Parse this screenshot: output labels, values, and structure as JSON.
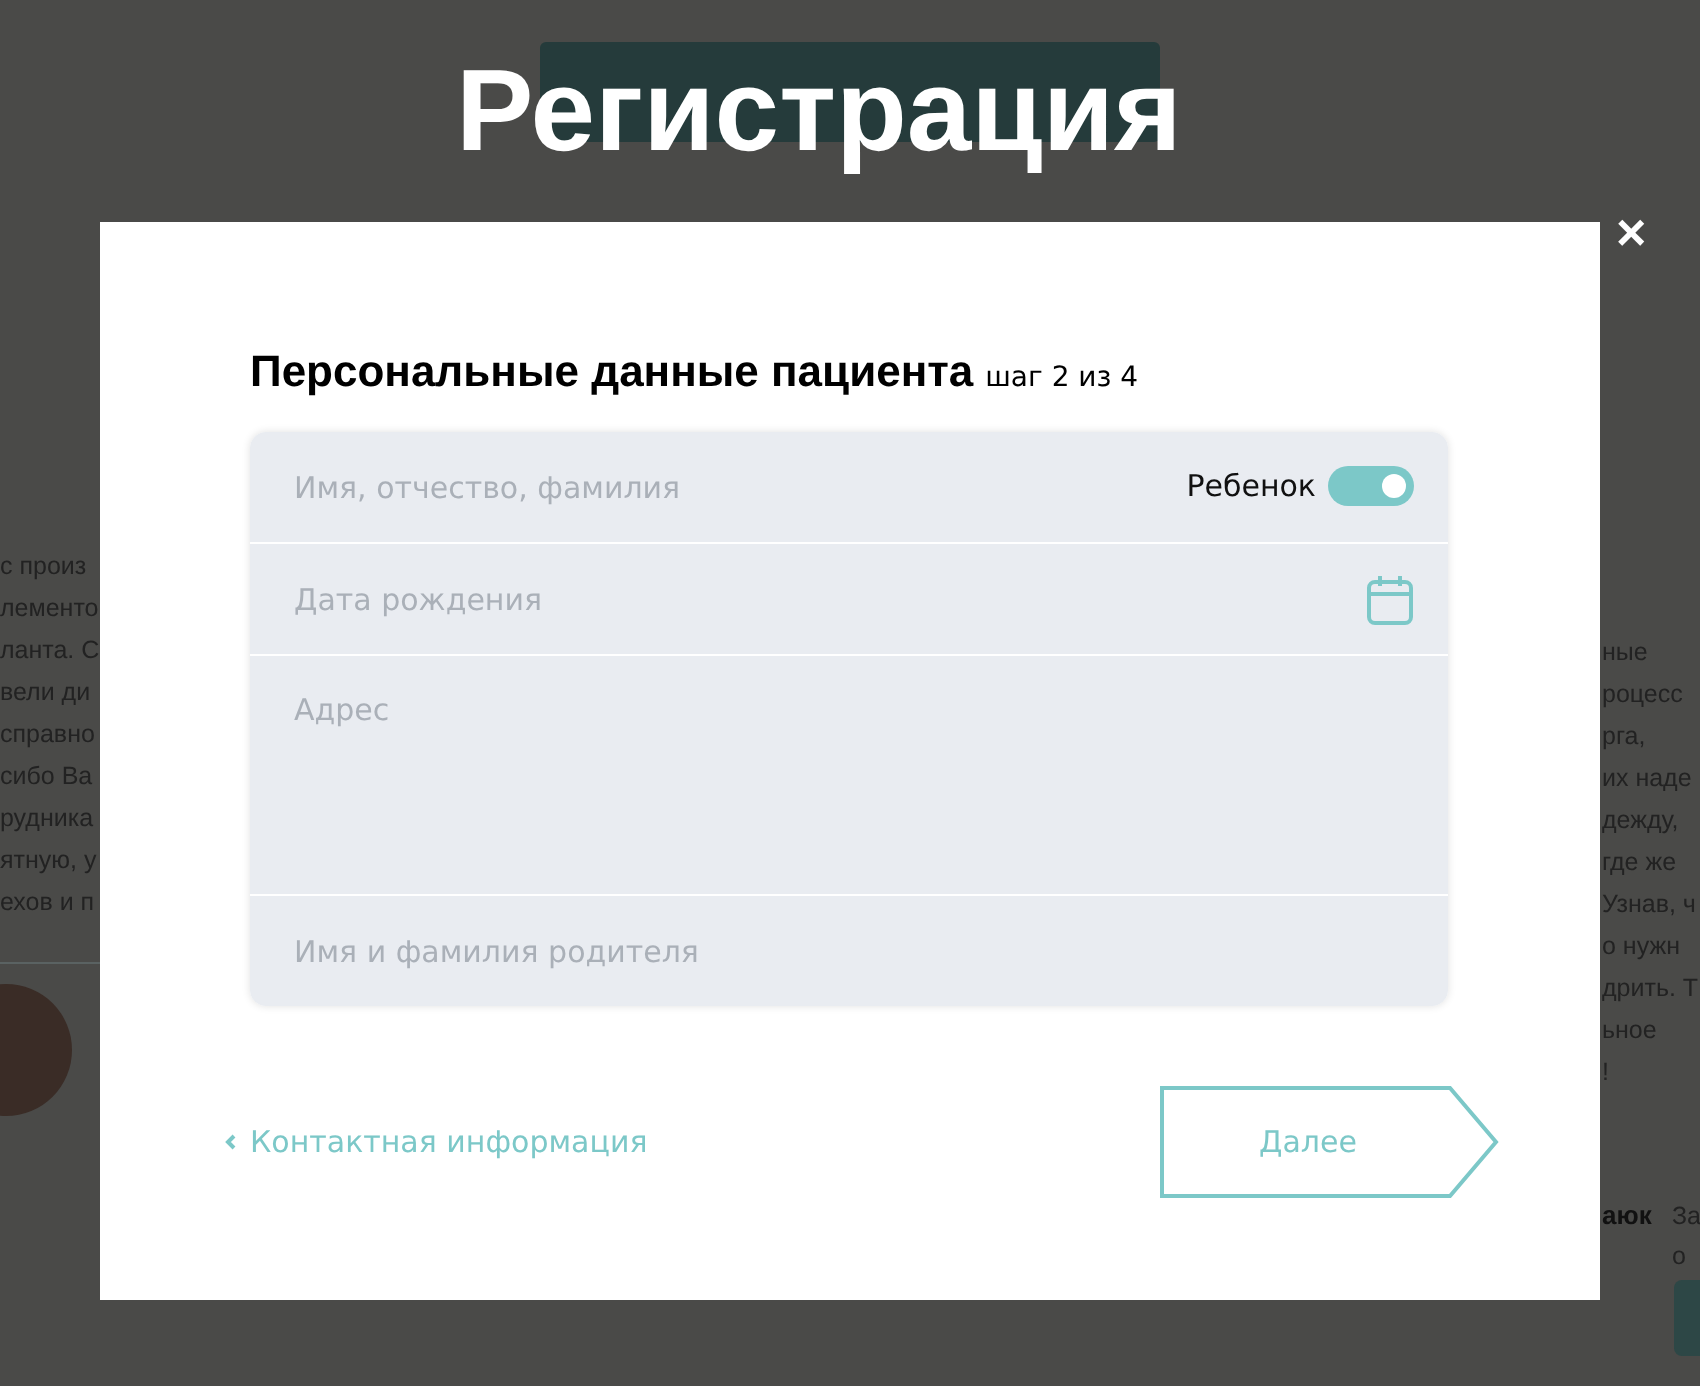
{
  "background": {
    "left_text": [
      "с произ",
      "лементо",
      "ланта. С",
      "вели ди",
      "справно",
      "сибо Ва",
      "рудника",
      "ятную, у",
      "ехов и п"
    ],
    "right_text": [
      "ные",
      "роцесс",
      "рга,",
      "их наде",
      "дежду,",
      "где же",
      "Узнав, ч",
      "о нужн",
      "дрить. Т",
      "ьное",
      "!"
    ],
    "reviewer_name": "аюк",
    "side_note": [
      "За",
      "о"
    ]
  },
  "page_title": "Регистрация",
  "modal": {
    "close": "×",
    "heading": "Персональные данные пациента",
    "step": "шаг 2 из 4",
    "fields": [
      {
        "kind": "text",
        "placeholder": "Имя, отчество, фамилия",
        "toggle": {
          "label": "Ребенок",
          "on": true
        }
      },
      {
        "kind": "date",
        "placeholder": "Дата рождения"
      },
      {
        "kind": "textarea",
        "placeholder": "Адрес"
      },
      {
        "kind": "text",
        "placeholder": "Имя и фамилия родителя"
      }
    ],
    "back_link": "Контактная информация",
    "next_button": "Далее"
  }
}
